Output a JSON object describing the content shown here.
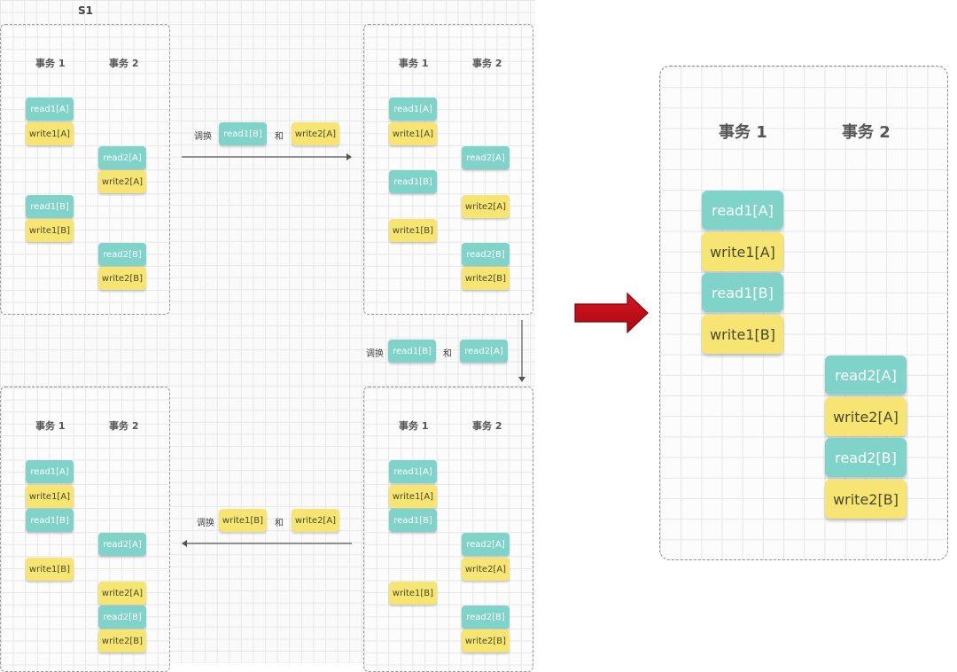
{
  "s_label": "S1",
  "headers": {
    "tx1": "事务 1",
    "tx2": "事务 2"
  },
  "ops": {
    "read1A": "read1[A]",
    "write1A": "write1[A]",
    "read1B": "read1[B]",
    "write1B": "write1[B]",
    "read2A": "read2[A]",
    "write2A": "write2[A]",
    "read2B": "read2[B]",
    "write2B": "write2[B]"
  },
  "swap_word": "调换",
  "and_word": "和",
  "colors": {
    "read": "#7fd3c8",
    "write": "#f6e473",
    "arrow": "#c0101a"
  },
  "panels": {
    "top_left": [
      "read1A",
      "write1A",
      "read2A",
      "write2A",
      "read1B",
      "write1B",
      "read2B",
      "write2B"
    ],
    "top_right": [
      "read1A",
      "write1A",
      "read2A",
      "read1B",
      "write2A",
      "write1B",
      "read2B",
      "write2B"
    ],
    "bottom_right": [
      "read1A",
      "write1A",
      "read1B",
      "read2A",
      "write2A",
      "write1B",
      "read2B",
      "write2B"
    ],
    "bottom_left": [
      "read1A",
      "write1A",
      "read1B",
      "read2A",
      "write1B",
      "write2A",
      "read2B",
      "write2B"
    ],
    "result": [
      "read1A",
      "write1A",
      "read1B",
      "write1B",
      "read2A",
      "write2A",
      "read2B",
      "write2B"
    ]
  },
  "swaps": {
    "step1": [
      "read1B",
      "write2A"
    ],
    "step2": [
      "read1B",
      "read2A"
    ],
    "step3": [
      "write1B",
      "write2A"
    ]
  }
}
